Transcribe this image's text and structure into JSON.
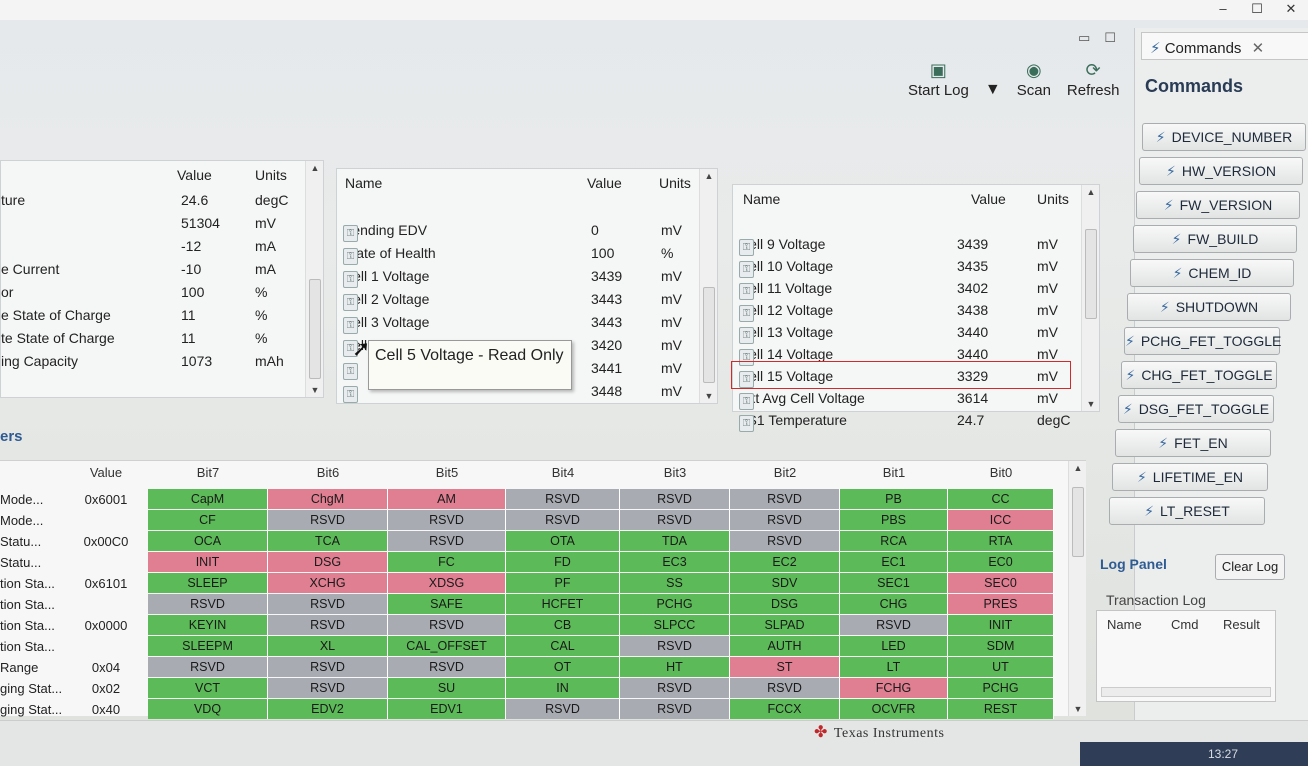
{
  "window": {
    "minimize": "–",
    "maximize": "☐",
    "close": "✕"
  },
  "view_controls": {
    "minimize": "▭",
    "maximize": "☐"
  },
  "toolbar": {
    "start_log": "Start Log",
    "scan": "Scan",
    "refresh": "Refresh",
    "dropdown": "▼"
  },
  "left_table": {
    "headers": {
      "value": "Value",
      "units": "Units"
    },
    "rows": [
      {
        "name": "ture",
        "value": "24.6",
        "units": "degC"
      },
      {
        "name": "",
        "value": "51304",
        "units": "mV"
      },
      {
        "name": "",
        "value": "-12",
        "units": "mA"
      },
      {
        "name": "e Current",
        "value": "-10",
        "units": "mA"
      },
      {
        "name": "or",
        "value": "100",
        "units": "%"
      },
      {
        "name": "e State of Charge",
        "value": "11",
        "units": "%"
      },
      {
        "name": "te State of Charge",
        "value": "11",
        "units": "%"
      },
      {
        "name": "ing Capacity",
        "value": "1073",
        "units": "mAh"
      }
    ]
  },
  "mid_table": {
    "headers": {
      "name": "Name",
      "value": "Value",
      "units": "Units"
    },
    "rows": [
      {
        "name": "Pending EDV",
        "value": "0",
        "units": "mV"
      },
      {
        "name": "State of Health",
        "value": "100",
        "units": "%"
      },
      {
        "name": "Cell 1 Voltage",
        "value": "3439",
        "units": "mV"
      },
      {
        "name": "Cell 2 Voltage",
        "value": "3443",
        "units": "mV"
      },
      {
        "name": "Cell 3 Voltage",
        "value": "3443",
        "units": "mV"
      },
      {
        "name": "Cell 4 Voltage",
        "value": "3420",
        "units": "mV"
      },
      {
        "name": "",
        "value": "3441",
        "units": "mV"
      },
      {
        "name": "",
        "value": "3448",
        "units": "mV"
      }
    ]
  },
  "tooltip": "Cell 5 Voltage - Read Only",
  "right_table": {
    "headers": {
      "name": "Name",
      "value": "Value",
      "units": "Units"
    },
    "rows": [
      {
        "name": "Cell 9 Voltage",
        "value": "3439",
        "units": "mV"
      },
      {
        "name": "Cell 10 Voltage",
        "value": "3435",
        "units": "mV"
      },
      {
        "name": "Cell 11 Voltage",
        "value": "3402",
        "units": "mV"
      },
      {
        "name": "Cell 12 Voltage",
        "value": "3438",
        "units": "mV"
      },
      {
        "name": "Cell 13 Voltage",
        "value": "3440",
        "units": "mV"
      },
      {
        "name": "Cell 14 Voltage",
        "value": "3440",
        "units": "mV"
      },
      {
        "name": "Cell 15 Voltage",
        "value": "3329",
        "units": "mV"
      },
      {
        "name": "Ext Avg Cell Voltage",
        "value": "3614",
        "units": "mV"
      },
      {
        "name": "TS1 Temperature",
        "value": "24.7",
        "units": "degC"
      }
    ]
  },
  "registers": {
    "title": "ers",
    "headers": [
      "Value",
      "Bit7",
      "Bit6",
      "Bit5",
      "Bit4",
      "Bit3",
      "Bit2",
      "Bit1",
      "Bit0"
    ],
    "rows": [
      {
        "name": "Mode...",
        "value": "0x6001",
        "bits": [
          [
            "CapM",
            "g"
          ],
          [
            "ChgM",
            "p"
          ],
          [
            "AM",
            "p"
          ],
          [
            "RSVD",
            "s"
          ],
          [
            "RSVD",
            "s"
          ],
          [
            "RSVD",
            "s"
          ],
          [
            "PB",
            "g"
          ],
          [
            "CC",
            "g"
          ]
        ]
      },
      {
        "name": "Mode...",
        "value": "",
        "bits": [
          [
            "CF",
            "g"
          ],
          [
            "RSVD",
            "s"
          ],
          [
            "RSVD",
            "s"
          ],
          [
            "RSVD",
            "s"
          ],
          [
            "RSVD",
            "s"
          ],
          [
            "RSVD",
            "s"
          ],
          [
            "PBS",
            "g"
          ],
          [
            "ICC",
            "p"
          ]
        ]
      },
      {
        "name": "Statu...",
        "value": "0x00C0",
        "bits": [
          [
            "OCA",
            "g"
          ],
          [
            "TCA",
            "g"
          ],
          [
            "RSVD",
            "s"
          ],
          [
            "OTA",
            "g"
          ],
          [
            "TDA",
            "g"
          ],
          [
            "RSVD",
            "s"
          ],
          [
            "RCA",
            "g"
          ],
          [
            "RTA",
            "g"
          ]
        ]
      },
      {
        "name": "Statu...",
        "value": "",
        "bits": [
          [
            "INIT",
            "p"
          ],
          [
            "DSG",
            "p"
          ],
          [
            "FC",
            "g"
          ],
          [
            "FD",
            "g"
          ],
          [
            "EC3",
            "g"
          ],
          [
            "EC2",
            "g"
          ],
          [
            "EC1",
            "g"
          ],
          [
            "EC0",
            "g"
          ]
        ]
      },
      {
        "name": "tion Sta...",
        "value": "0x6101",
        "bits": [
          [
            "SLEEP",
            "g"
          ],
          [
            "XCHG",
            "p"
          ],
          [
            "XDSG",
            "p"
          ],
          [
            "PF",
            "g"
          ],
          [
            "SS",
            "g"
          ],
          [
            "SDV",
            "g"
          ],
          [
            "SEC1",
            "g"
          ],
          [
            "SEC0",
            "p"
          ]
        ]
      },
      {
        "name": "tion Sta...",
        "value": "",
        "bits": [
          [
            "RSVD",
            "s"
          ],
          [
            "RSVD",
            "s"
          ],
          [
            "SAFE",
            "g"
          ],
          [
            "HCFET",
            "g"
          ],
          [
            "PCHG",
            "g"
          ],
          [
            "DSG",
            "g"
          ],
          [
            "CHG",
            "g"
          ],
          [
            "PRES",
            "p"
          ]
        ]
      },
      {
        "name": "tion Sta...",
        "value": "0x0000",
        "bits": [
          [
            "KEYIN",
            "g"
          ],
          [
            "RSVD",
            "s"
          ],
          [
            "RSVD",
            "s"
          ],
          [
            "CB",
            "g"
          ],
          [
            "SLPCC",
            "g"
          ],
          [
            "SLPAD",
            "g"
          ],
          [
            "RSVD",
            "s"
          ],
          [
            "INIT",
            "g"
          ]
        ]
      },
      {
        "name": "tion Sta...",
        "value": "",
        "bits": [
          [
            "SLEEPM",
            "g"
          ],
          [
            "XL",
            "g"
          ],
          [
            "CAL_OFFSET",
            "g"
          ],
          [
            "CAL",
            "g"
          ],
          [
            "RSVD",
            "s"
          ],
          [
            "AUTH",
            "g"
          ],
          [
            "LED",
            "g"
          ],
          [
            "SDM",
            "g"
          ]
        ]
      },
      {
        "name": "Range",
        "value": "0x04",
        "bits": [
          [
            "RSVD",
            "s"
          ],
          [
            "RSVD",
            "s"
          ],
          [
            "RSVD",
            "s"
          ],
          [
            "OT",
            "g"
          ],
          [
            "HT",
            "g"
          ],
          [
            "ST",
            "p"
          ],
          [
            "LT",
            "g"
          ],
          [
            "UT",
            "g"
          ]
        ]
      },
      {
        "name": "ging Stat...",
        "value": "0x02",
        "bits": [
          [
            "VCT",
            "g"
          ],
          [
            "RSVD",
            "s"
          ],
          [
            "SU",
            "g"
          ],
          [
            "IN",
            "g"
          ],
          [
            "RSVD",
            "s"
          ],
          [
            "RSVD",
            "s"
          ],
          [
            "FCHG",
            "p"
          ],
          [
            "PCHG",
            "g"
          ]
        ]
      },
      {
        "name": "ging Stat...",
        "value": "0x40",
        "bits": [
          [
            "VDQ",
            "g"
          ],
          [
            "EDV2",
            "g"
          ],
          [
            "EDV1",
            "g"
          ],
          [
            "RSVD",
            "s"
          ],
          [
            "RSVD",
            "s"
          ],
          [
            "FCCX",
            "g"
          ],
          [
            "OCVFR",
            "g"
          ],
          [
            "REST",
            "g"
          ]
        ]
      }
    ]
  },
  "commands": {
    "tab_label": "Commands",
    "heading": "Commands",
    "buttons": [
      "DEVICE_NUMBER",
      "HW_VERSION",
      "FW_VERSION",
      "FW_BUILD",
      "CHEM_ID",
      "SHUTDOWN",
      "PCHG_FET_TOGGLE",
      "CHG_FET_TOGGLE",
      "DSG_FET_TOGGLE",
      "FET_EN",
      "LIFETIME_EN",
      "LT_RESET"
    ]
  },
  "log_panel": {
    "title": "Log Panel",
    "clear_button": "Clear Log",
    "transaction_title": "Transaction Log",
    "columns": [
      "Name",
      "Cmd",
      "Result"
    ]
  },
  "footer": {
    "brand": "Texas Instruments",
    "clock": "13:27"
  },
  "colors": {
    "set_bit": "#5cba58",
    "alert_bit": "#df7f91",
    "reserved_bit": "#a8abb2",
    "highlight": "#d12a2a"
  }
}
